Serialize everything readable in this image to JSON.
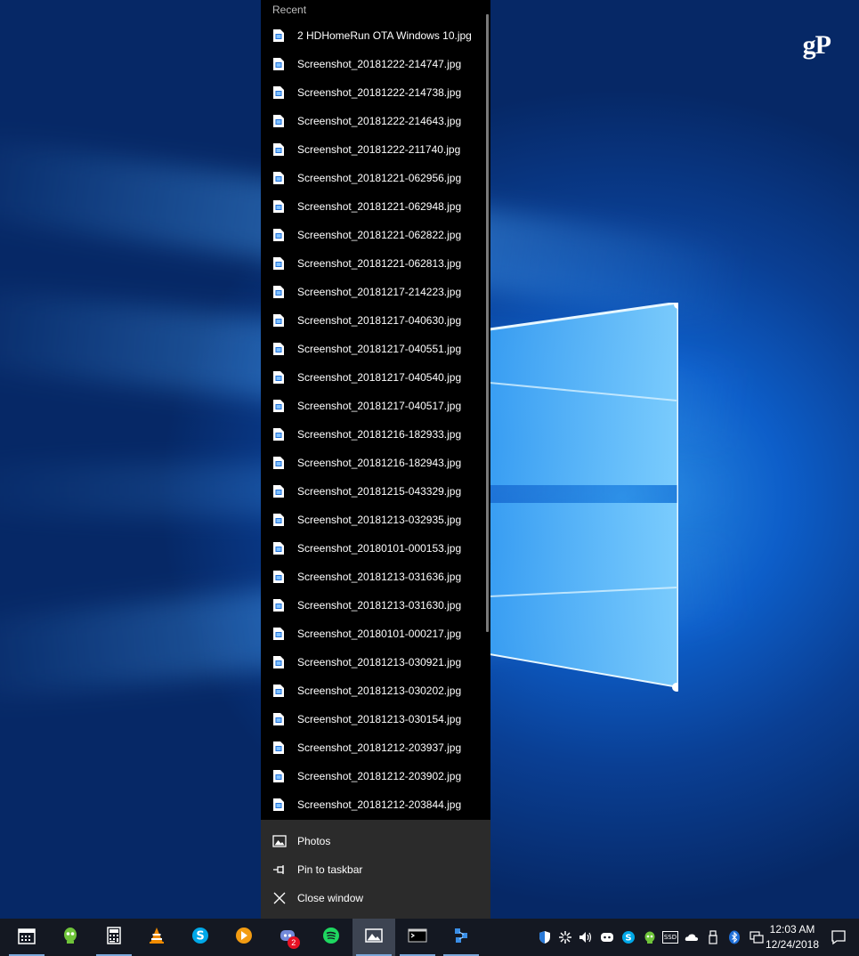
{
  "watermark": "gP",
  "jumplist": {
    "section_label": "Recent",
    "recent_items": [
      "2 HDHomeRun OTA Windows 10.jpg",
      "Screenshot_20181222-214747.jpg",
      "Screenshot_20181222-214738.jpg",
      "Screenshot_20181222-214643.jpg",
      "Screenshot_20181222-211740.jpg",
      "Screenshot_20181221-062956.jpg",
      "Screenshot_20181221-062948.jpg",
      "Screenshot_20181221-062822.jpg",
      "Screenshot_20181221-062813.jpg",
      "Screenshot_20181217-214223.jpg",
      "Screenshot_20181217-040630.jpg",
      "Screenshot_20181217-040551.jpg",
      "Screenshot_20181217-040540.jpg",
      "Screenshot_20181217-040517.jpg",
      "Screenshot_20181216-182933.jpg",
      "Screenshot_20181216-182943.jpg",
      "Screenshot_20181215-043329.jpg",
      "Screenshot_20181213-032935.jpg",
      "Screenshot_20180101-000153.jpg",
      "Screenshot_20181213-031636.jpg",
      "Screenshot_20181213-031630.jpg",
      "Screenshot_20180101-000217.jpg",
      "Screenshot_20181213-030921.jpg",
      "Screenshot_20181213-030202.jpg",
      "Screenshot_20181213-030154.jpg",
      "Screenshot_20181212-203937.jpg",
      "Screenshot_20181212-203902.jpg",
      "Screenshot_20181212-203844.jpg"
    ],
    "tasks": {
      "app": "Photos",
      "pin": "Pin to taskbar",
      "close": "Close window"
    }
  },
  "taskbar": {
    "apps": [
      {
        "icon": "calendar-icon",
        "running": true,
        "active": false
      },
      {
        "icon": "vpn-icon",
        "running": false,
        "active": false
      },
      {
        "icon": "calculator-icon",
        "running": true,
        "active": false
      },
      {
        "icon": "vlc-icon",
        "running": false,
        "active": false
      },
      {
        "icon": "skype-icon",
        "running": false,
        "active": false
      },
      {
        "icon": "plex-icon",
        "running": false,
        "active": false
      },
      {
        "icon": "discord-icon",
        "running": false,
        "active": false,
        "badge": "2"
      },
      {
        "icon": "spotify-icon",
        "running": false,
        "active": false
      },
      {
        "icon": "photos-icon",
        "running": true,
        "active": true
      },
      {
        "icon": "terminal-icon",
        "running": true,
        "active": false
      },
      {
        "icon": "network-icon",
        "running": true,
        "active": false
      }
    ],
    "tray_icons": [
      "defender-icon",
      "sync-icon",
      "volume-icon",
      "discord-tray-icon",
      "skype-tray-icon",
      "vpn-tray-icon",
      "ssd-icon",
      "onedrive-icon",
      "usb-icon",
      "bluetooth-icon",
      "network-tray-icon"
    ],
    "tray_ssd_label": "SSD",
    "clock_time": "12:03 AM",
    "clock_date": "12/24/2018"
  },
  "colors": {
    "jumplist_bg": "#000000",
    "tasks_bg": "#2b2b2b",
    "taskbar_bg": "#141822",
    "accent": "#1e90ff"
  }
}
